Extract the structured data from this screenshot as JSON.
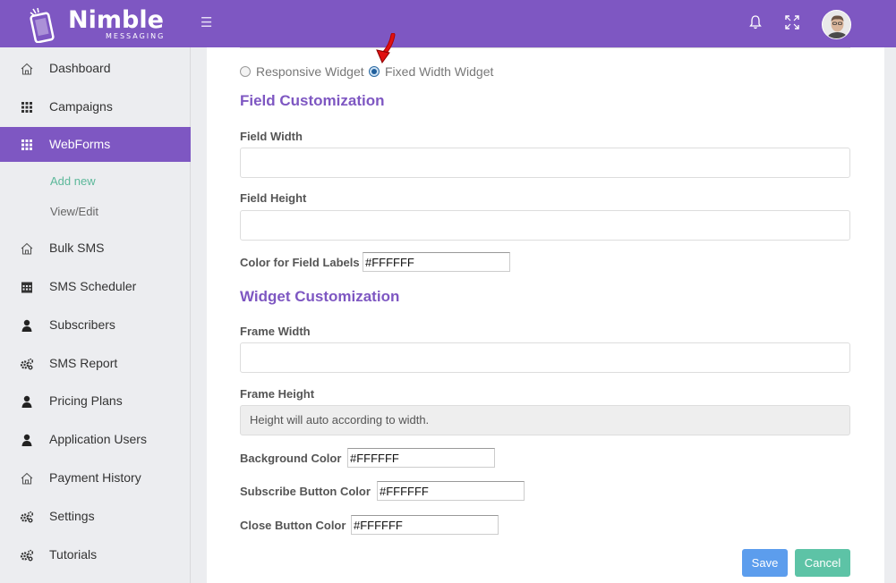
{
  "app": {
    "brand": "Nimble",
    "brand_sub": "MESSAGING"
  },
  "sidebar": {
    "items": [
      {
        "label": "Dashboard",
        "icon": "home-icon"
      },
      {
        "label": "Campaigns",
        "icon": "grid-icon"
      },
      {
        "label": "WebForms",
        "icon": "grid-icon"
      },
      {
        "label": "Bulk SMS",
        "icon": "home-icon"
      },
      {
        "label": "SMS Scheduler",
        "icon": "calendar-icon"
      },
      {
        "label": "Subscribers",
        "icon": "user-icon"
      },
      {
        "label": "SMS Report",
        "icon": "gears-icon"
      },
      {
        "label": "Pricing Plans",
        "icon": "user-icon"
      },
      {
        "label": "Application Users",
        "icon": "user-icon"
      },
      {
        "label": "Payment History",
        "icon": "home-icon"
      },
      {
        "label": "Settings",
        "icon": "gears-icon"
      },
      {
        "label": "Tutorials",
        "icon": "gears-icon"
      }
    ],
    "webforms_sub": [
      {
        "label": "Add new"
      },
      {
        "label": "View/Edit"
      }
    ],
    "active": "WebForms"
  },
  "form": {
    "widget_type": {
      "options": [
        "Responsive Widget",
        "Fixed Width Widget"
      ],
      "selected": "Fixed Width Widget"
    },
    "field_section_title": "Field Customization",
    "field_width_label": "Field Width",
    "field_width_value": "",
    "field_height_label": "Field Height",
    "field_height_value": "",
    "field_label_color_label": "Color for Field Labels",
    "field_label_color_value": "#FFFFFF",
    "widget_section_title": "Widget Customization",
    "frame_width_label": "Frame Width",
    "frame_width_value": "",
    "frame_height_label": "Frame Height",
    "frame_height_value": "Height will auto according to width.",
    "bg_color_label": "Background Color",
    "bg_color_value": "#FFFFFF",
    "subscribe_color_label": "Subscribe Button Color",
    "subscribe_color_value": "#FFFFFF",
    "close_color_label": "Close Button Color",
    "close_color_value": "#FFFFFF",
    "save_label": "Save",
    "cancel_label": "Cancel"
  },
  "colors": {
    "brand_purple": "#7e57c2",
    "save_blue": "#5c9ded",
    "cancel_green": "#5dc3a6",
    "sub_active_green": "#5cb89a",
    "annotation_red": "#e01010"
  }
}
